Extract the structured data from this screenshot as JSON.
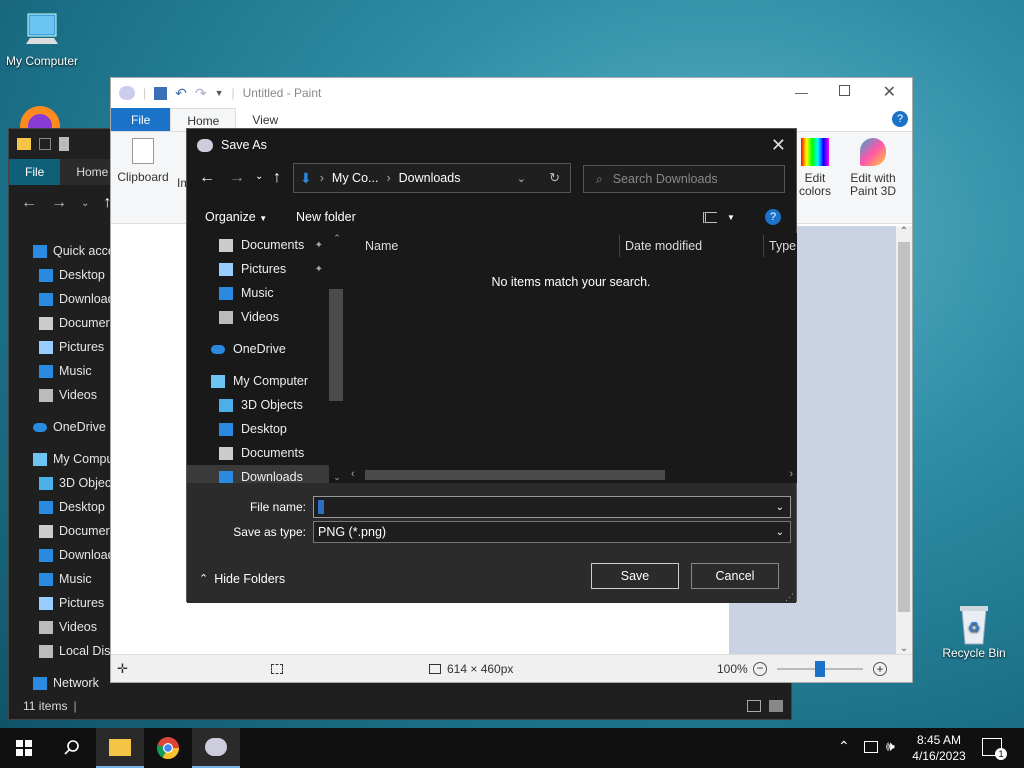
{
  "desktop": {
    "my_computer": "My Computer",
    "recycle_bin": "Recycle Bin"
  },
  "explorer": {
    "ribbon": {
      "file": "File",
      "home": "Home"
    },
    "sidebar": [
      {
        "label": "Quick acce",
        "icon": "star-icon",
        "top": true
      },
      {
        "label": "Desktop",
        "icon": "desktop-icon"
      },
      {
        "label": "Download",
        "icon": "download-icon"
      },
      {
        "label": "Documer",
        "icon": "document-icon"
      },
      {
        "label": "Pictures",
        "icon": "pictures-icon"
      },
      {
        "label": "Music",
        "icon": "music-icon"
      },
      {
        "label": "Videos",
        "icon": "videos-icon"
      },
      {
        "label": "OneDrive",
        "icon": "cloud-icon",
        "top": true
      },
      {
        "label": "My Compu",
        "icon": "computer-icon",
        "top": true
      },
      {
        "label": "3D Objec",
        "icon": "cube-icon"
      },
      {
        "label": "Desktop",
        "icon": "desktop-icon"
      },
      {
        "label": "Documer",
        "icon": "document-icon"
      },
      {
        "label": "Download",
        "icon": "download-icon"
      },
      {
        "label": "Music",
        "icon": "music-icon"
      },
      {
        "label": "Pictures",
        "icon": "pictures-icon"
      },
      {
        "label": "Videos",
        "icon": "videos-icon"
      },
      {
        "label": "Local Dis",
        "icon": "drive-icon"
      },
      {
        "label": "Network",
        "icon": "network-icon",
        "top": true
      }
    ],
    "status": "11 items"
  },
  "paint": {
    "title": "Untitled - Paint",
    "tabs": {
      "file": "File",
      "home": "Home",
      "view": "View"
    },
    "ribbon": {
      "clipboard": "Clipboard",
      "im": "Im",
      "edit_colors": "Edit colors",
      "edit_colors_1": "Edit",
      "edit_colors_2": "colors",
      "paint3d_1": "Edit with",
      "paint3d_2": "Paint 3D"
    },
    "status": {
      "size": "614 × 460px",
      "zoom": "100%"
    }
  },
  "dialog": {
    "title": "Save As",
    "breadcrumb": {
      "part1": "My Co...",
      "part2": "Downloads"
    },
    "search_placeholder": "Search Downloads",
    "organize": "Organize",
    "new_folder": "New folder",
    "tree": [
      {
        "label": "Documents",
        "icon": "document-icon",
        "indent": 1,
        "pin": true
      },
      {
        "label": "Pictures",
        "icon": "pictures-icon",
        "indent": 1,
        "pin": true
      },
      {
        "label": "Music",
        "icon": "music-icon",
        "indent": 1
      },
      {
        "label": "Videos",
        "icon": "videos-icon",
        "indent": 1
      },
      {
        "label": "OneDrive",
        "icon": "cloud-icon",
        "indent": 0,
        "gap": true
      },
      {
        "label": "My Computer",
        "icon": "computer-icon",
        "indent": 0,
        "gap": true
      },
      {
        "label": "3D Objects",
        "icon": "cube-icon",
        "indent": 1
      },
      {
        "label": "Desktop",
        "icon": "desktop-icon",
        "indent": 1
      },
      {
        "label": "Documents",
        "icon": "document-icon",
        "indent": 1
      },
      {
        "label": "Downloads",
        "icon": "download-icon",
        "indent": 1,
        "selected": true
      }
    ],
    "columns": {
      "name": "Name",
      "date": "Date modified",
      "type": "Type"
    },
    "empty_message": "No items match your search.",
    "file_name_label": "File name:",
    "file_name_value": "",
    "save_type_label": "Save as type:",
    "save_type_value": "PNG (*.png)",
    "hide_folders": "Hide Folders",
    "save": "Save",
    "cancel": "Cancel"
  },
  "taskbar": {
    "time": "8:45 AM",
    "date": "4/16/2023",
    "notification_count": "1"
  },
  "colors": {
    "accent": "#1a73c9",
    "explorer_file": "#0e5f78",
    "dialog_bg": "#191919"
  }
}
